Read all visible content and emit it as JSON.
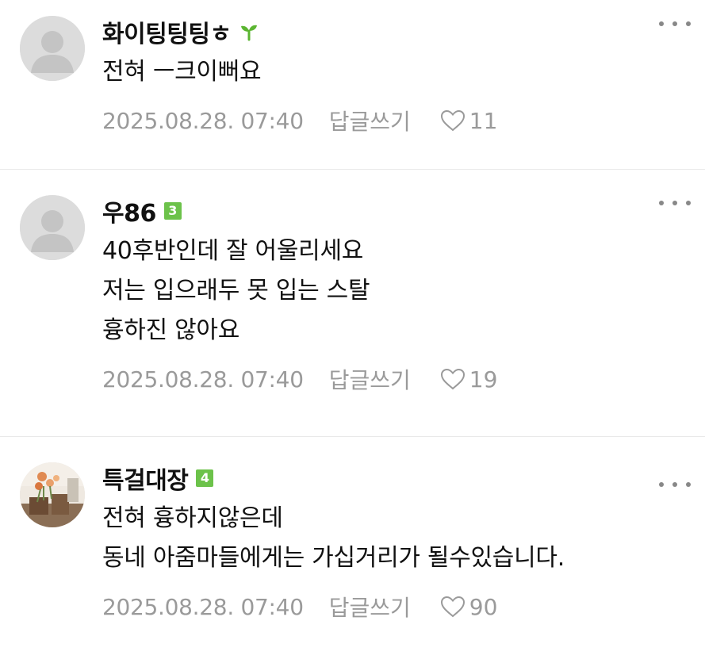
{
  "comments": [
    {
      "nickname": "화이팅팅팅ㅎ",
      "badge_icon": "sprout-icon",
      "avatar": "default-avatar",
      "lines": [
        "전혀 ㅡ크이뻐요"
      ],
      "date": "2025.08.28. 07:40",
      "reply_label": "답글쓰기",
      "likes": "11"
    },
    {
      "nickname": "우86",
      "badge": "3",
      "avatar": "default-avatar",
      "lines": [
        "40후반인데 잘 어울리세요",
        "저는 입으래두 못 입는 스탈",
        "흉하진 않아요"
      ],
      "date": "2025.08.28. 07:40",
      "reply_label": "답글쓰기",
      "likes": "19"
    },
    {
      "nickname": "특걸대장",
      "badge": "4",
      "avatar": "flower-photo-avatar",
      "lines": [
        "전혀 흉하지않은데",
        "동네 아줌마들에게는 가십거리가 될수있습니다."
      ],
      "date": "2025.08.28. 07:40",
      "reply_label": "답글쓰기",
      "likes": "90"
    }
  ],
  "colors": {
    "badge_green": "#6cc24a",
    "meta_gray": "#9a9a9a",
    "divider": "#e9e9e9"
  }
}
